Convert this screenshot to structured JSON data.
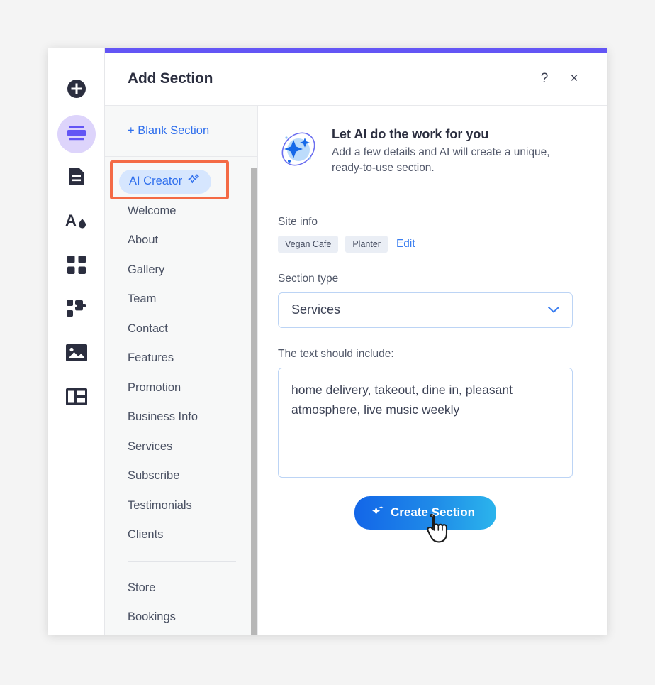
{
  "rail": {
    "items": [
      {
        "name": "add-element",
        "icon": "plus-circle-icon",
        "active": false
      },
      {
        "name": "sections",
        "icon": "sections-icon",
        "active": true
      },
      {
        "name": "pages",
        "icon": "page-icon",
        "active": false
      },
      {
        "name": "design",
        "icon": "text-theme-icon",
        "active": false
      },
      {
        "name": "apps",
        "icon": "apps-grid-icon",
        "active": false
      },
      {
        "name": "integrations",
        "icon": "puzzle-icon",
        "active": false
      },
      {
        "name": "media",
        "icon": "image-icon",
        "active": false
      },
      {
        "name": "layouts",
        "icon": "layout-table-icon",
        "active": false
      }
    ]
  },
  "panel": {
    "title": "Add Section",
    "help_label": "?",
    "close_label": "×",
    "accent_color": "#6355f5"
  },
  "section_list": {
    "blank_section_label": "Blank Section",
    "blank_section_plus": "+",
    "selected": "AI Creator",
    "selected_icon": "sparkle-icon",
    "items_primary": [
      "AI Creator",
      "Welcome",
      "About",
      "Gallery",
      "Team",
      "Contact",
      "Features",
      "Promotion",
      "Business Info",
      "Services",
      "Subscribe",
      "Testimonials",
      "Clients"
    ],
    "items_secondary": [
      "Store",
      "Bookings"
    ]
  },
  "ai_panel": {
    "banner": {
      "icon": "ai-sparkle-orbit-icon",
      "title": "Let AI do the work for you",
      "description": "Add a few details and AI will create a unique, ready-to-use section."
    },
    "site_info": {
      "label": "Site info",
      "tags": [
        "Vegan Cafe",
        "Planter"
      ],
      "edit_label": "Edit"
    },
    "section_type": {
      "label": "Section type",
      "value": "Services",
      "chevron_icon": "chevron-down-icon"
    },
    "prompt": {
      "label": "The text should include:",
      "value": "home delivery, takeout, dine in, pleasant atmosphere, live music weekly",
      "placeholder": "The text should include:"
    },
    "create_button": {
      "label": "Create Section",
      "icon": "sparkle-icon"
    }
  },
  "annotation": {
    "highlight_color": "#f46a45",
    "target": "AI Creator"
  }
}
